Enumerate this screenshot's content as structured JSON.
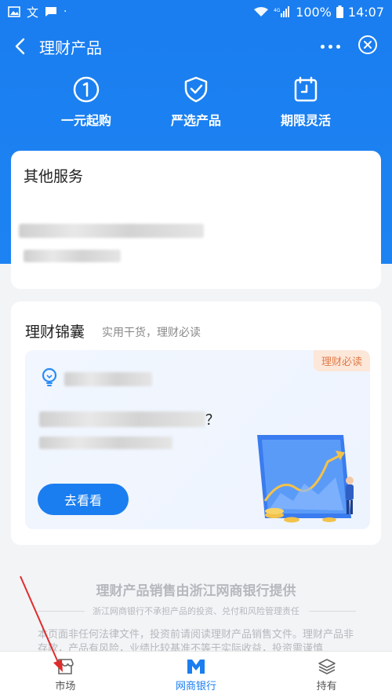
{
  "status_bar": {
    "battery": "100%",
    "time": "14:07"
  },
  "nav": {
    "title": "理财产品"
  },
  "features": [
    {
      "label": "一元起购",
      "icon": "one-circle-icon"
    },
    {
      "label": "严选产品",
      "icon": "shield-check-icon"
    },
    {
      "label": "期限灵活",
      "icon": "calendar-clock-icon"
    }
  ],
  "services": {
    "title": "其他服务"
  },
  "tips": {
    "title": "理财锦囊",
    "subtitle": "实用干货，理财必读",
    "badge": "理财必读",
    "question_mark": "？",
    "button": "去看看"
  },
  "footer": {
    "title": "理财产品销售由浙江网商银行提供",
    "subtitle": "浙江网商银行不承担产品的投资、兑付和风险管理责任",
    "disclaimer": "本页面非任何法律文件，投资前请阅读理财产品销售文件。理财产品非存款，产品有风险，业绩比较基准不等于实际收益，投资需谨慎"
  },
  "tab_bar": [
    {
      "label": "市场",
      "icon": "store-icon",
      "active": false
    },
    {
      "label": "网商银行",
      "icon": "mybank-logo-icon",
      "active": true
    },
    {
      "label": "持有",
      "icon": "holdings-icon",
      "active": false
    }
  ],
  "colors": {
    "primary": "#1a7ef0",
    "badge_text": "#e07b48",
    "badge_bg": "#fde7d9",
    "annotation_arrow": "#e02b2b"
  }
}
